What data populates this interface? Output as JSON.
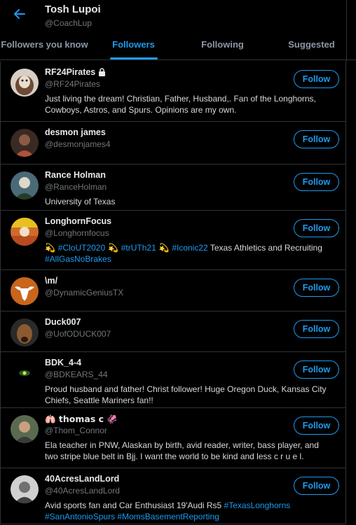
{
  "header": {
    "title": "Tosh Lupoi",
    "subtitle": "@CoachLup"
  },
  "tabs": [
    {
      "label": "Followers you know",
      "active": false
    },
    {
      "label": "Followers",
      "active": true
    },
    {
      "label": "Following",
      "active": false
    },
    {
      "label": "Suggested",
      "active": false
    }
  ],
  "follow_label": "Follow",
  "colors": {
    "accent": "#1d9bf0",
    "background": "#000000",
    "divider": "#2f3336"
  },
  "users": [
    {
      "name": "RF24Pirates",
      "handle": "@RF24Pirates",
      "protected": true,
      "bio_parts": [
        "Just living the dream! Christian, Father, Husband,. Fan of the Longhorns, Cowboys, Astros, and Spurs. Opinions are my own."
      ]
    },
    {
      "name": "desmon james",
      "handle": "@desmonjames4"
    },
    {
      "name": "Rance Holman",
      "handle": "@RanceHolman",
      "bio_parts": [
        "University of Texas"
      ]
    },
    {
      "name": "LonghornFocus",
      "handle": "@Longhornfocus",
      "bio_parts": [
        "💫 ",
        "#CloUT2020",
        " 💫 ",
        "#trUTh21",
        " 💫 ",
        "#Iconic22",
        " Texas Athletics and Recruiting ",
        "#AllGasNoBrakes"
      ]
    },
    {
      "name": "\\m/",
      "handle": "@DynamicGeniusTX"
    },
    {
      "name": "Duck007",
      "handle": "@UofODUCK007"
    },
    {
      "name": "BDK_4-4",
      "handle": "@BDKEARS_44",
      "bio_parts": [
        "Proud husband and father! Christ follower! Huge Oregon Duck, Kansas City Chiefs, Seattle Mariners fan!!"
      ]
    },
    {
      "name": "🫁 thomas c 🦑",
      "handle": "@Thom_Connor",
      "bio_parts": [
        "Ela teacher in PNW, Alaskan by birth, avid reader, writer, bass player, and two stripe blue belt in Bjj. I want the world to be kind and less c r u e l."
      ]
    },
    {
      "name": "40AcresLandLord",
      "handle": "@40AcresLandLord",
      "bio_parts": [
        "Avid sports fan and Car Enthusiast 19'Audi Rs5 ",
        "#TexasLonghorns",
        " ",
        "#SanAntonioSpurs",
        " ",
        "#MomsBasementReporting"
      ]
    }
  ]
}
